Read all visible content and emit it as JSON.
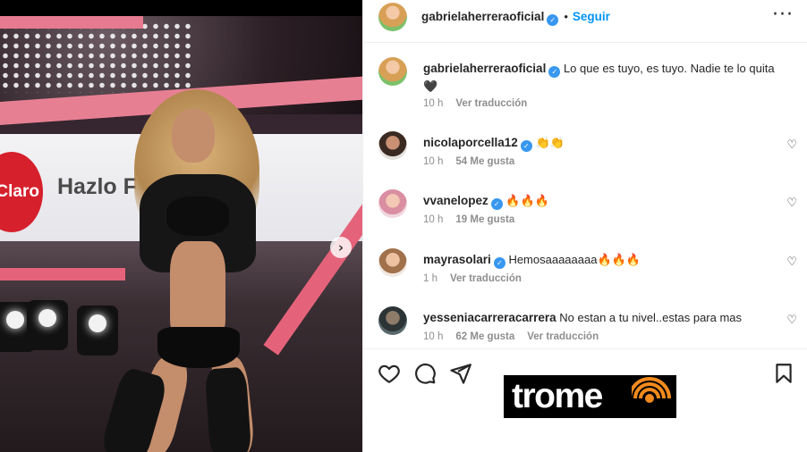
{
  "post": {
    "username": "gabrielaherreraoficial",
    "follow_label": "Seguir",
    "more_icon": "more-horizontal-icon",
    "verified_icon": "verified-badge-icon"
  },
  "caption": {
    "username": "gabrielaherreraoficial",
    "text": "Lo que es tuyo, es tuyo. Nadie te lo quita 🖤",
    "time": "10 h",
    "translate": "Ver traducción"
  },
  "media": {
    "screen_brand": "Claro",
    "screen_text": "Hazlo F",
    "next_icon": "chevron-right-icon"
  },
  "comments": [
    {
      "username": "nicolaporcella12",
      "verified": true,
      "text": "👏👏",
      "time": "10 h",
      "likes": "54 Me gusta",
      "translate": ""
    },
    {
      "username": "vvanelopez",
      "verified": true,
      "text": "🔥🔥🔥",
      "time": "10 h",
      "likes": "19 Me gusta",
      "translate": ""
    },
    {
      "username": "mayrasolari",
      "verified": true,
      "text": "Hemosaaaaaaaa🔥🔥🔥",
      "time": "1 h",
      "likes": "",
      "translate": "Ver traducción"
    },
    {
      "username": "yesseniacarreracarrera",
      "verified": false,
      "text": "No estan a tu nivel..estas para mas",
      "time": "10 h",
      "likes": "62 Me gusta",
      "translate": "Ver traducción"
    }
  ],
  "actions": {
    "like_icon": "heart-icon",
    "comment_icon": "comment-icon",
    "share_icon": "share-icon",
    "save_icon": "bookmark-icon"
  },
  "watermark": {
    "brand": "trome"
  },
  "colors": {
    "link_blue": "#0095f6",
    "verified_blue": "#3897f0",
    "meta_gray": "#8e8e8e",
    "trome_orange": "#f28a1e"
  }
}
